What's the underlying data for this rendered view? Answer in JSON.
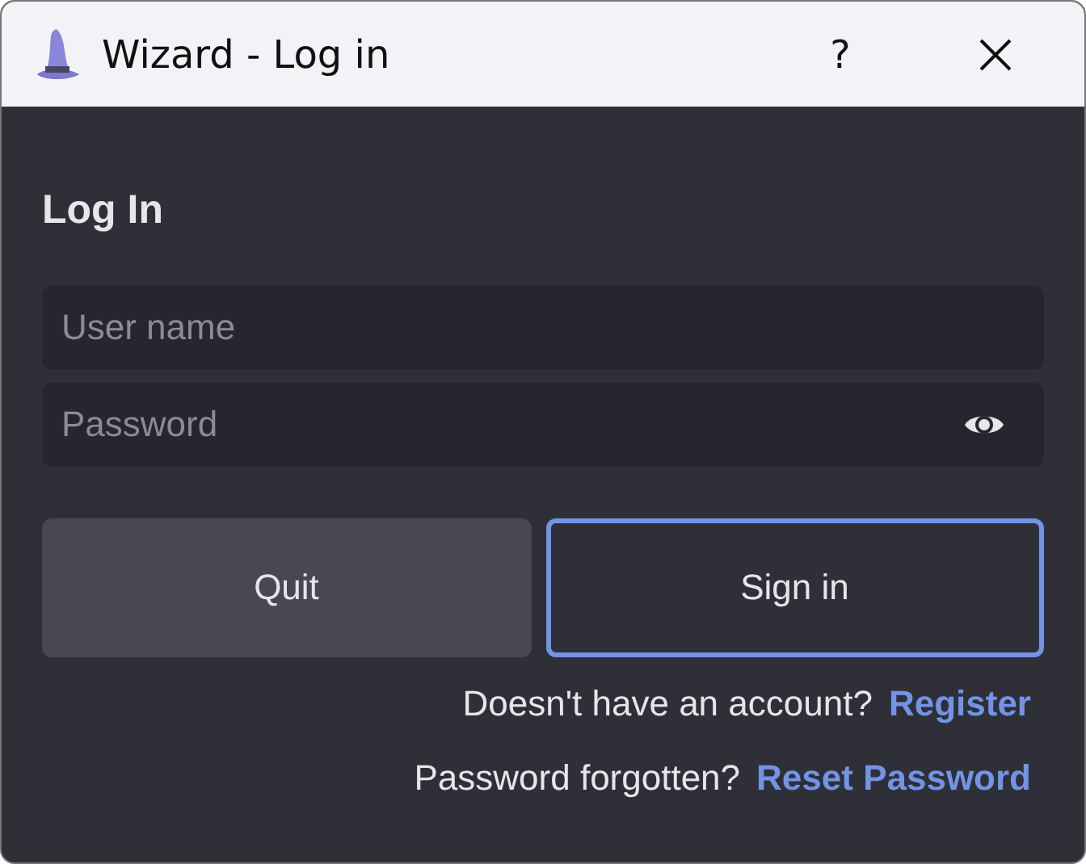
{
  "window": {
    "title": "Wizard - Log in",
    "help": "?"
  },
  "heading": "Log In",
  "fields": [
    {
      "placeholder": "User name",
      "kind": "text"
    },
    {
      "placeholder": "Password",
      "kind": "password"
    }
  ],
  "buttons": [
    {
      "label": "Quit",
      "kind": "secondary"
    },
    {
      "label": "Sign in",
      "kind": "primary"
    }
  ],
  "links": [
    {
      "text": "Doesn't have an account?",
      "link": "Register"
    },
    {
      "text": "Password forgotten?",
      "link": "Reset Password"
    }
  ]
}
